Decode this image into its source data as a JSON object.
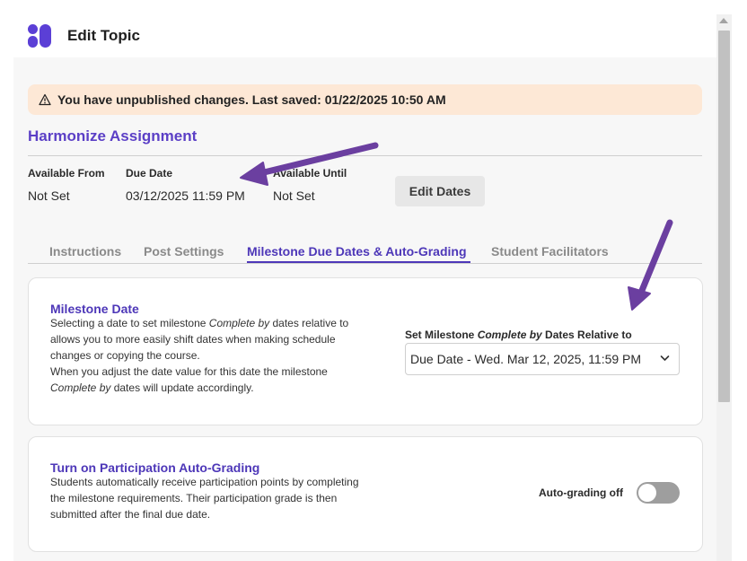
{
  "header": {
    "title": "Edit Topic"
  },
  "banner": {
    "text": "You have unpublished changes. Last saved: 01/22/2025 10:50 AM"
  },
  "assignment": {
    "title": "Harmonize Assignment"
  },
  "dates": [
    {
      "label": "Available From",
      "value": "Not Set"
    },
    {
      "label": "Due Date",
      "value": "03/12/2025 11:59 PM"
    },
    {
      "label": "Available Until",
      "value": "Not Set"
    }
  ],
  "edit_dates_label": "Edit Dates",
  "tabs": [
    {
      "label": "Instructions",
      "active": false
    },
    {
      "label": "Post Settings",
      "active": false
    },
    {
      "label": "Milestone Due Dates & Auto-Grading",
      "active": true
    },
    {
      "label": "Student Facilitators",
      "active": false
    }
  ],
  "milestone": {
    "title": "Milestone Date",
    "line1_pre": "Selecting a date to set milestone ",
    "complete_by": "Complete by",
    "line1_post": " dates relative to",
    "line2": "allows you to more easily shift dates when making schedule",
    "line3": "changes or copying the course.",
    "line4": "When you adjust the date value for this date the milestone",
    "line5_post": " dates will update accordingly.",
    "select_label_pre": "Set Milestone ",
    "select_label_post": " Dates Relative to",
    "select_value": "Due Date - Wed. Mar 12, 2025, 11:59 PM"
  },
  "autograding": {
    "title": "Turn on Participation Auto-Grading",
    "line1": "Students automatically receive participation points by completing",
    "line2": "the milestone requirements. Their participation grade is then",
    "line3": "submitted after the final due date.",
    "toggle_label": "Auto-grading off",
    "toggle_on": false
  },
  "colors": {
    "accent": "#4d37b8",
    "banner_bg": "#fde8d6",
    "annotation_arrow": "#6b3fa0"
  }
}
